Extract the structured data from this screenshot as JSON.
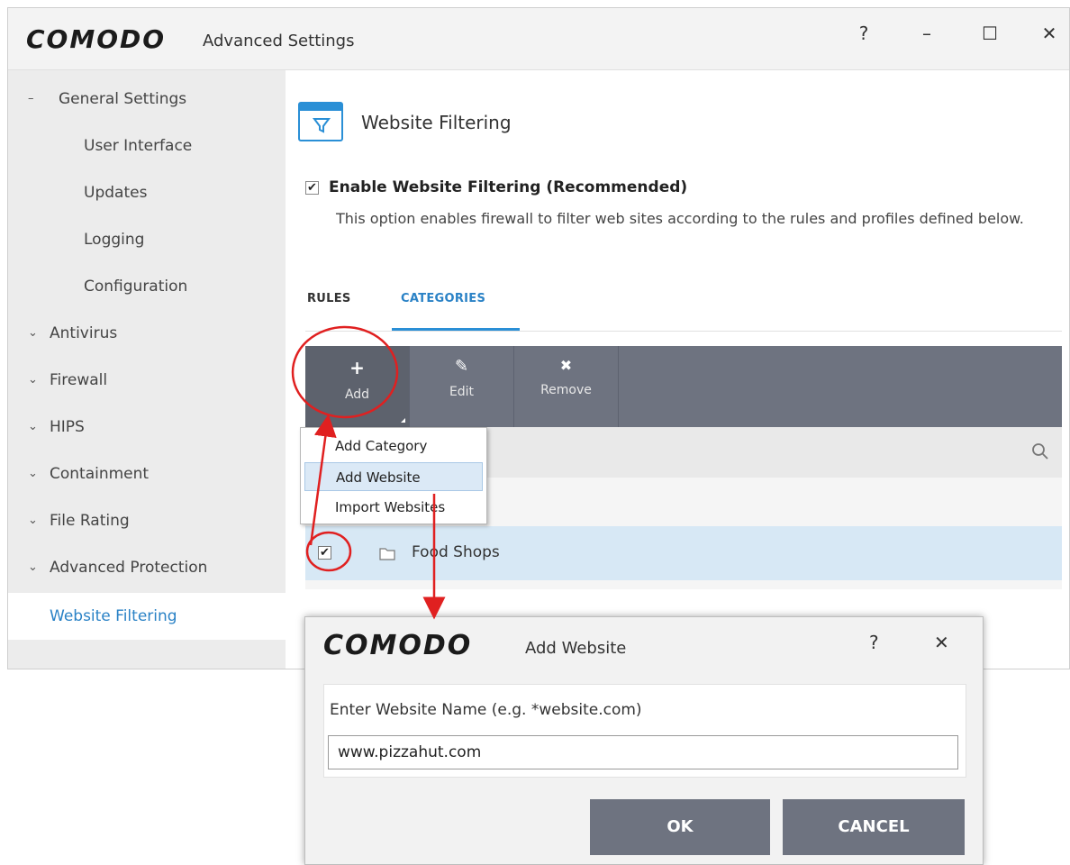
{
  "window": {
    "logo": "COMODO",
    "title": "Advanced Settings",
    "help": "?",
    "minimize": "–",
    "maximize": "☐",
    "close": "✕"
  },
  "sidebar": {
    "items": [
      {
        "label": "General Settings",
        "toggle": "–"
      },
      {
        "label": "User Interface"
      },
      {
        "label": "Updates"
      },
      {
        "label": "Logging"
      },
      {
        "label": "Configuration"
      },
      {
        "label": "Antivirus",
        "toggle": "⌄"
      },
      {
        "label": "Firewall",
        "toggle": "⌄"
      },
      {
        "label": "HIPS",
        "toggle": "⌄"
      },
      {
        "label": "Containment",
        "toggle": "⌄"
      },
      {
        "label": "File Rating",
        "toggle": "⌄"
      },
      {
        "label": "Advanced Protection",
        "toggle": "⌄"
      },
      {
        "label": "Website Filtering",
        "active": true
      }
    ]
  },
  "main": {
    "title": "Website Filtering",
    "enable_label": "Enable Website Filtering (Recommended)",
    "enable_checked": true,
    "enable_description": "This option enables firewall to filter web sites according to the rules and profiles defined below.",
    "tabs": [
      {
        "label": "RULES"
      },
      {
        "label": "CATEGORIES",
        "selected": true
      }
    ],
    "toolbar": [
      {
        "label": "Add",
        "icon": "+"
      },
      {
        "label": "Edit",
        "icon": "✎"
      },
      {
        "label": "Remove",
        "icon": "✖"
      }
    ],
    "row": {
      "label": "Food Shops",
      "checked": true
    }
  },
  "add_menu": {
    "items": [
      {
        "label": "Add Category"
      },
      {
        "label": "Add Website",
        "highlighted": true
      },
      {
        "label": "Import Websites"
      }
    ]
  },
  "dialog": {
    "logo": "COMODO",
    "title": "Add Website",
    "help": "?",
    "close": "✕",
    "prompt": "Enter Website Name (e.g. *website.com)",
    "input_value": "www.pizzahut.com",
    "ok_label": "OK",
    "cancel_label": "CANCEL"
  },
  "colors": {
    "accent": "#2a82c6",
    "toolbar": "#6e7380",
    "annotation": "#e02020"
  }
}
